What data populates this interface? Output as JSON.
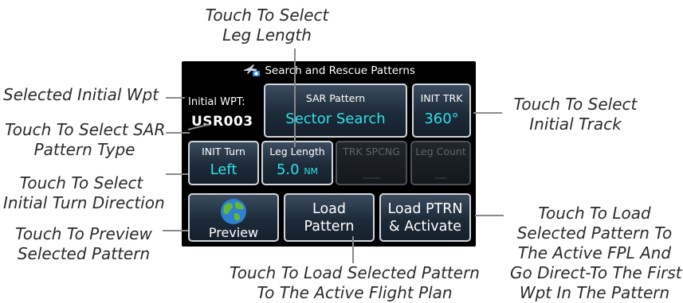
{
  "screen": {
    "title": "Search and Rescue Patterns",
    "initial_wpt": {
      "label": "Initial WPT:",
      "value": "USR003"
    },
    "sar_pattern": {
      "label": "SAR Pattern",
      "value": "Sector Search"
    },
    "init_trk": {
      "label": "INIT TRK",
      "value": "360°"
    },
    "init_turn": {
      "label": "INIT Turn",
      "value": "Left"
    },
    "leg_length": {
      "label": "Leg Length",
      "value": "5.0",
      "unit": "NM"
    },
    "trk_spcng": {
      "label": "TRK SPCNG",
      "value": "___"
    },
    "leg_count": {
      "label": "Leg Count",
      "value": "__"
    },
    "preview": {
      "label": "Preview"
    },
    "load_pattern": {
      "line1": "Load",
      "line2": "Pattern"
    },
    "load_activate": {
      "line1": "Load PTRN",
      "line2": "& Activate"
    }
  },
  "callouts": {
    "leg_length": [
      "Touch To Select",
      "Leg Length"
    ],
    "initial_wpt": [
      "Selected Initial Wpt"
    ],
    "sar_type": [
      "Touch To Select SAR",
      "Pattern Type"
    ],
    "turn": [
      "Touch To Select",
      "Initial Turn Direction"
    ],
    "preview": [
      "Touch To Preview",
      "Selected Pattern"
    ],
    "track": [
      "Touch To Select",
      "Initial Track"
    ],
    "load": [
      "Touch To Load Selected Pattern",
      "To The Active Flight Plan"
    ],
    "activate": [
      "Touch To Load",
      "Selected Pattern To",
      "The Active FPL And",
      "Go Direct-To The First",
      "Wpt In The Pattern"
    ]
  }
}
